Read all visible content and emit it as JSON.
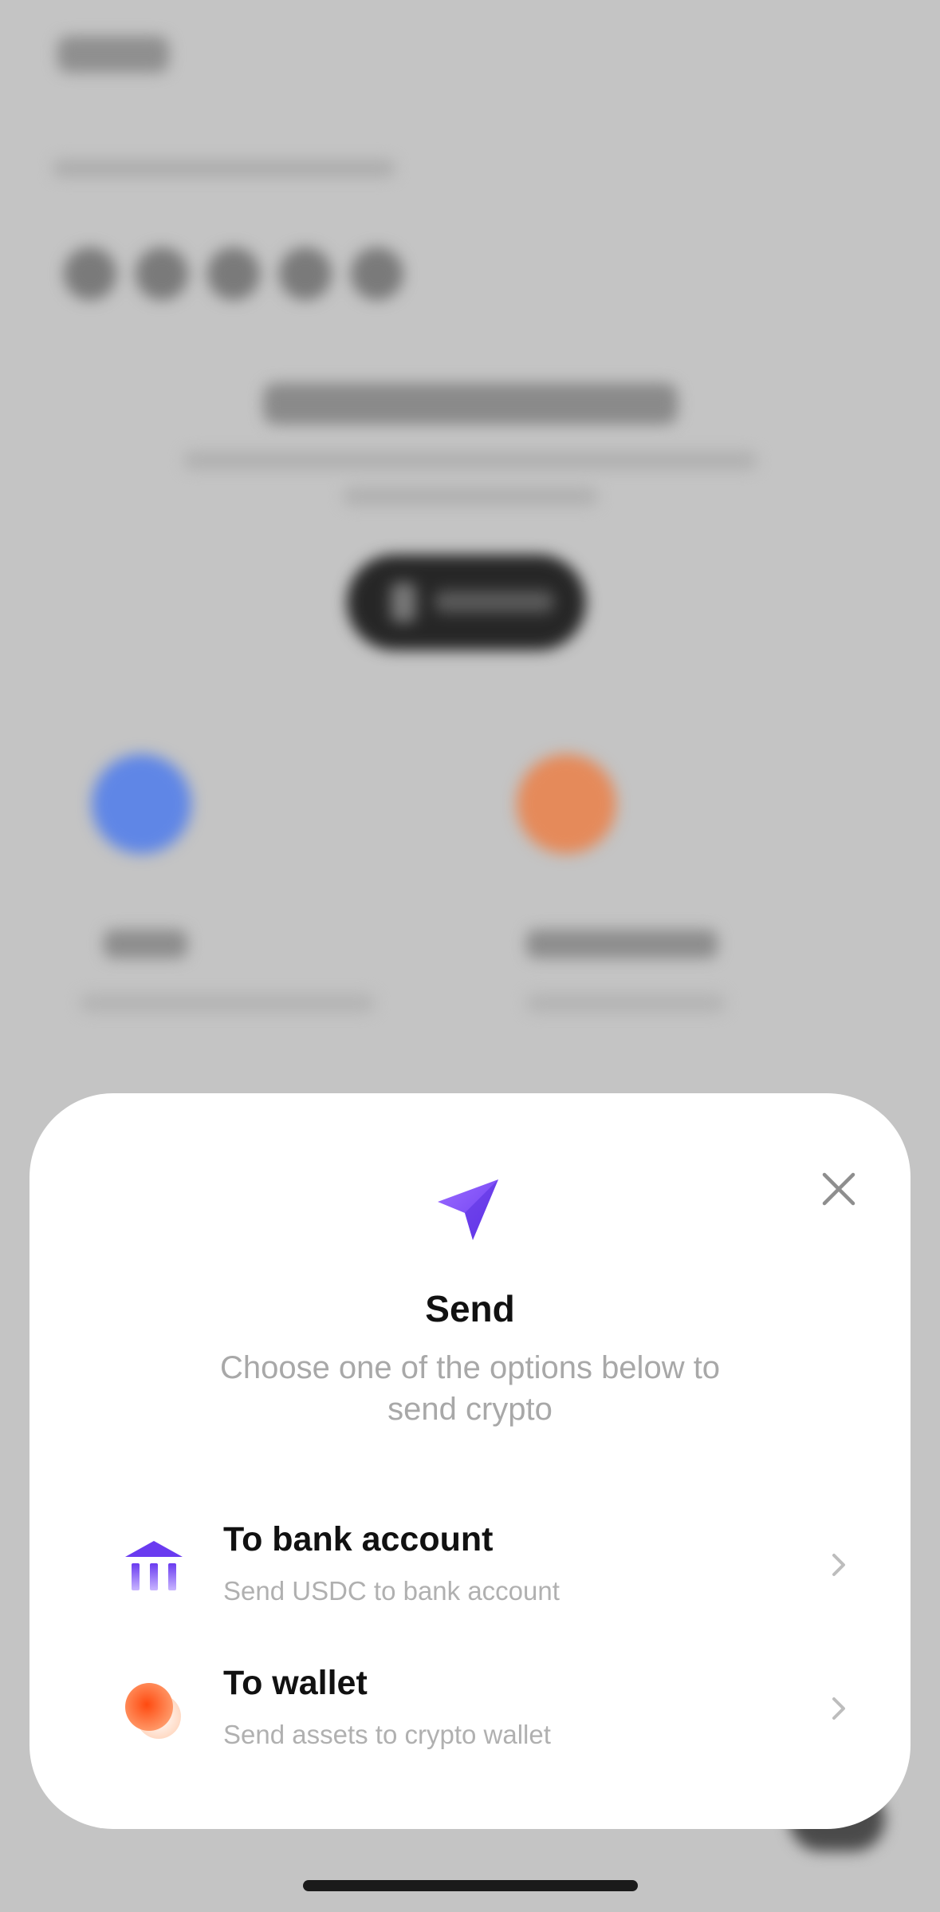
{
  "sheet": {
    "title": "Send",
    "subtitle": "Choose one of the options below to send crypto",
    "close_icon": "close-icon",
    "header_icon": "paper-plane-icon",
    "options": [
      {
        "title": "To bank account",
        "subtitle": "Send USDC to bank account",
        "icon": "bank-icon"
      },
      {
        "title": "To wallet",
        "subtitle": "Send assets to crypto wallet",
        "icon": "wallet-coins-icon"
      }
    ]
  },
  "colors": {
    "accent_purple": "#7B4DFF",
    "accent_orange": "#FF6A2A",
    "overlay": "#C4C4C4"
  }
}
